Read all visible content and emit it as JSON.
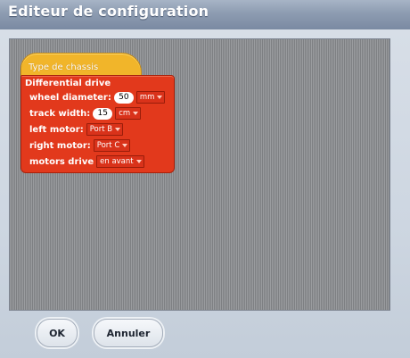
{
  "window": {
    "title": "Editeur de configuration"
  },
  "hat_block": {
    "label": "Type de chassis"
  },
  "drive_block": {
    "title": "Differential drive",
    "wheel_diameter": {
      "label": "wheel diameter:",
      "value": "50",
      "unit": "mm"
    },
    "track_width": {
      "label": "track width:",
      "value": "15",
      "unit": "cm"
    },
    "left_motor": {
      "label": "left motor:",
      "value": "Port B"
    },
    "right_motor": {
      "label": "right motor:",
      "value": "Port C"
    },
    "motors_drive": {
      "label": "motors drive",
      "value": "en avant"
    }
  },
  "buttons": {
    "ok": "OK",
    "cancel": "Annuler"
  },
  "colors": {
    "hat_block": "#f1b52a",
    "drive_block": "#e2391c",
    "canvas": "#8c8e91",
    "titlebar": "#8d9cb1"
  }
}
